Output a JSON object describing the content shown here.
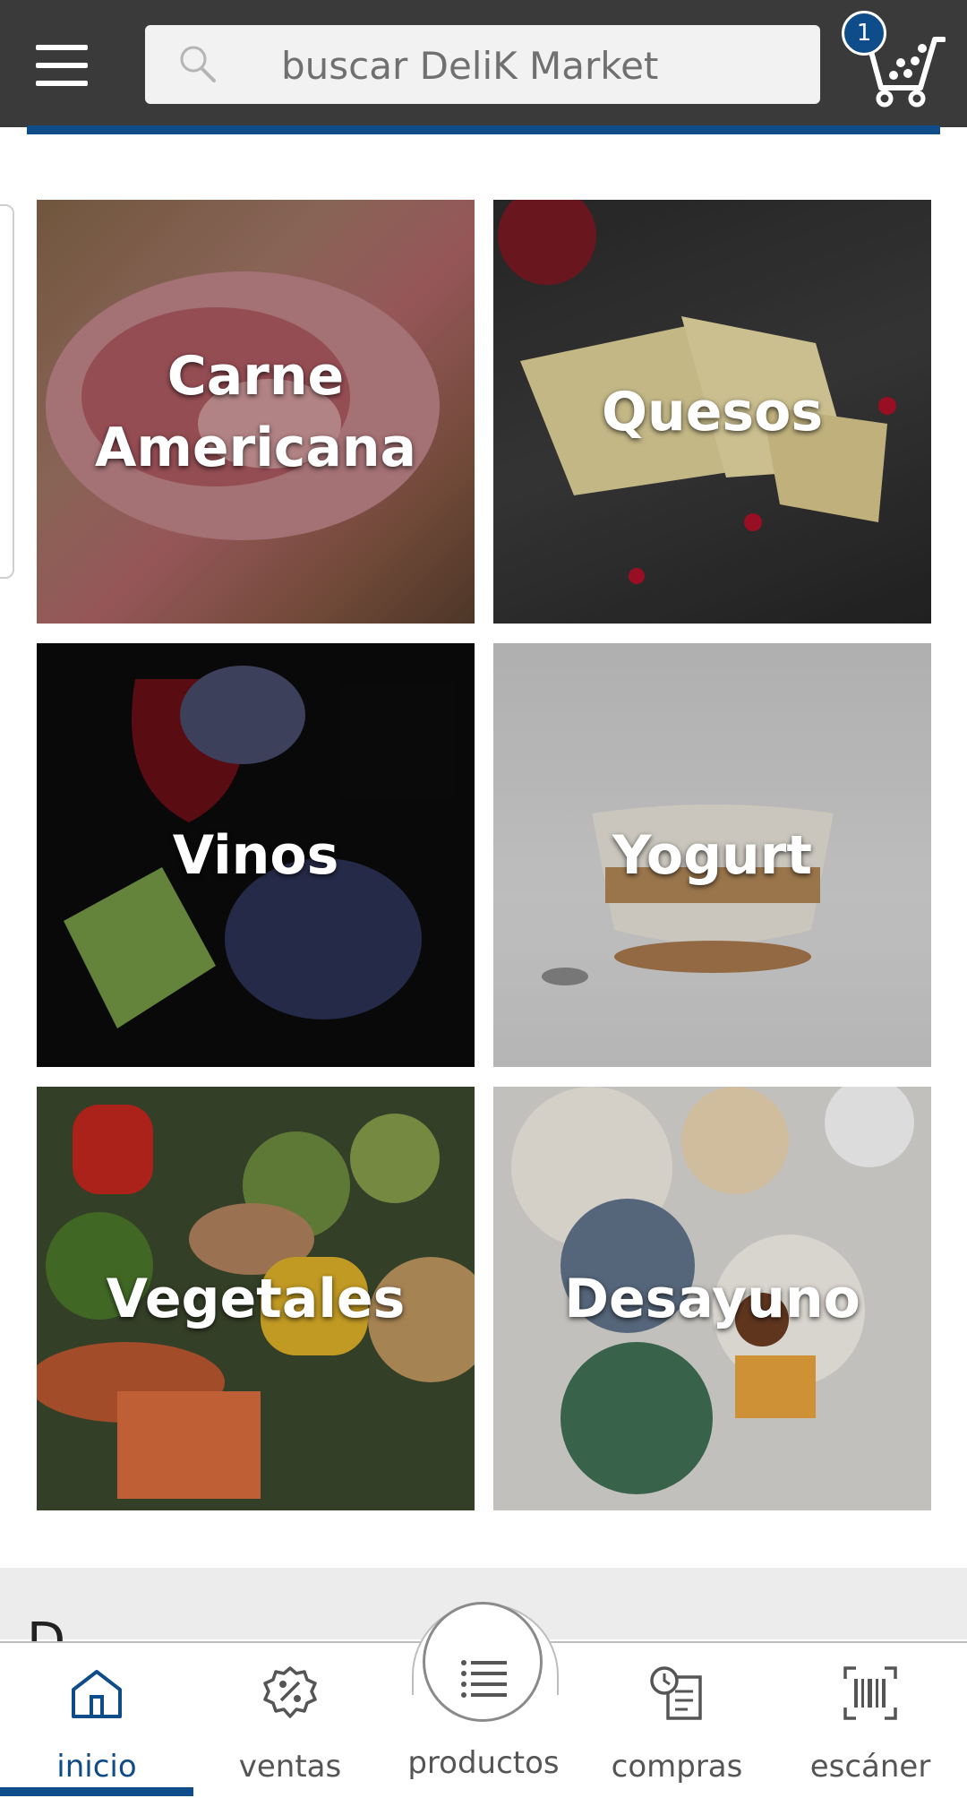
{
  "header": {
    "search_placeholder": "buscar DeliK Market",
    "cart_count": "1",
    "icons": [
      "menu-icon",
      "search-icon",
      "cart-icon"
    ]
  },
  "categories": [
    {
      "label": "Carne\nAmericana"
    },
    {
      "label": "Quesos"
    },
    {
      "label": "Vinos"
    },
    {
      "label": "Yogurt"
    },
    {
      "label": "Vegetales"
    },
    {
      "label": "Desayuno"
    }
  ],
  "promo": {
    "partial_heading": "D"
  },
  "bottom_nav": {
    "items": [
      {
        "label": "inicio",
        "icon": "home-icon",
        "active": true
      },
      {
        "label": "ventas",
        "icon": "discount-badge-icon",
        "active": false
      },
      {
        "label": "productos",
        "icon": "list-icon",
        "active": false
      },
      {
        "label": "compras",
        "icon": "purchase-history-icon",
        "active": false
      },
      {
        "label": "escáner",
        "icon": "barcode-scanner-icon",
        "active": false
      }
    ]
  },
  "colors": {
    "header_bg": "#3a3a3a",
    "accent": "#0f4c8a",
    "search_bg": "#f2f2f2"
  }
}
